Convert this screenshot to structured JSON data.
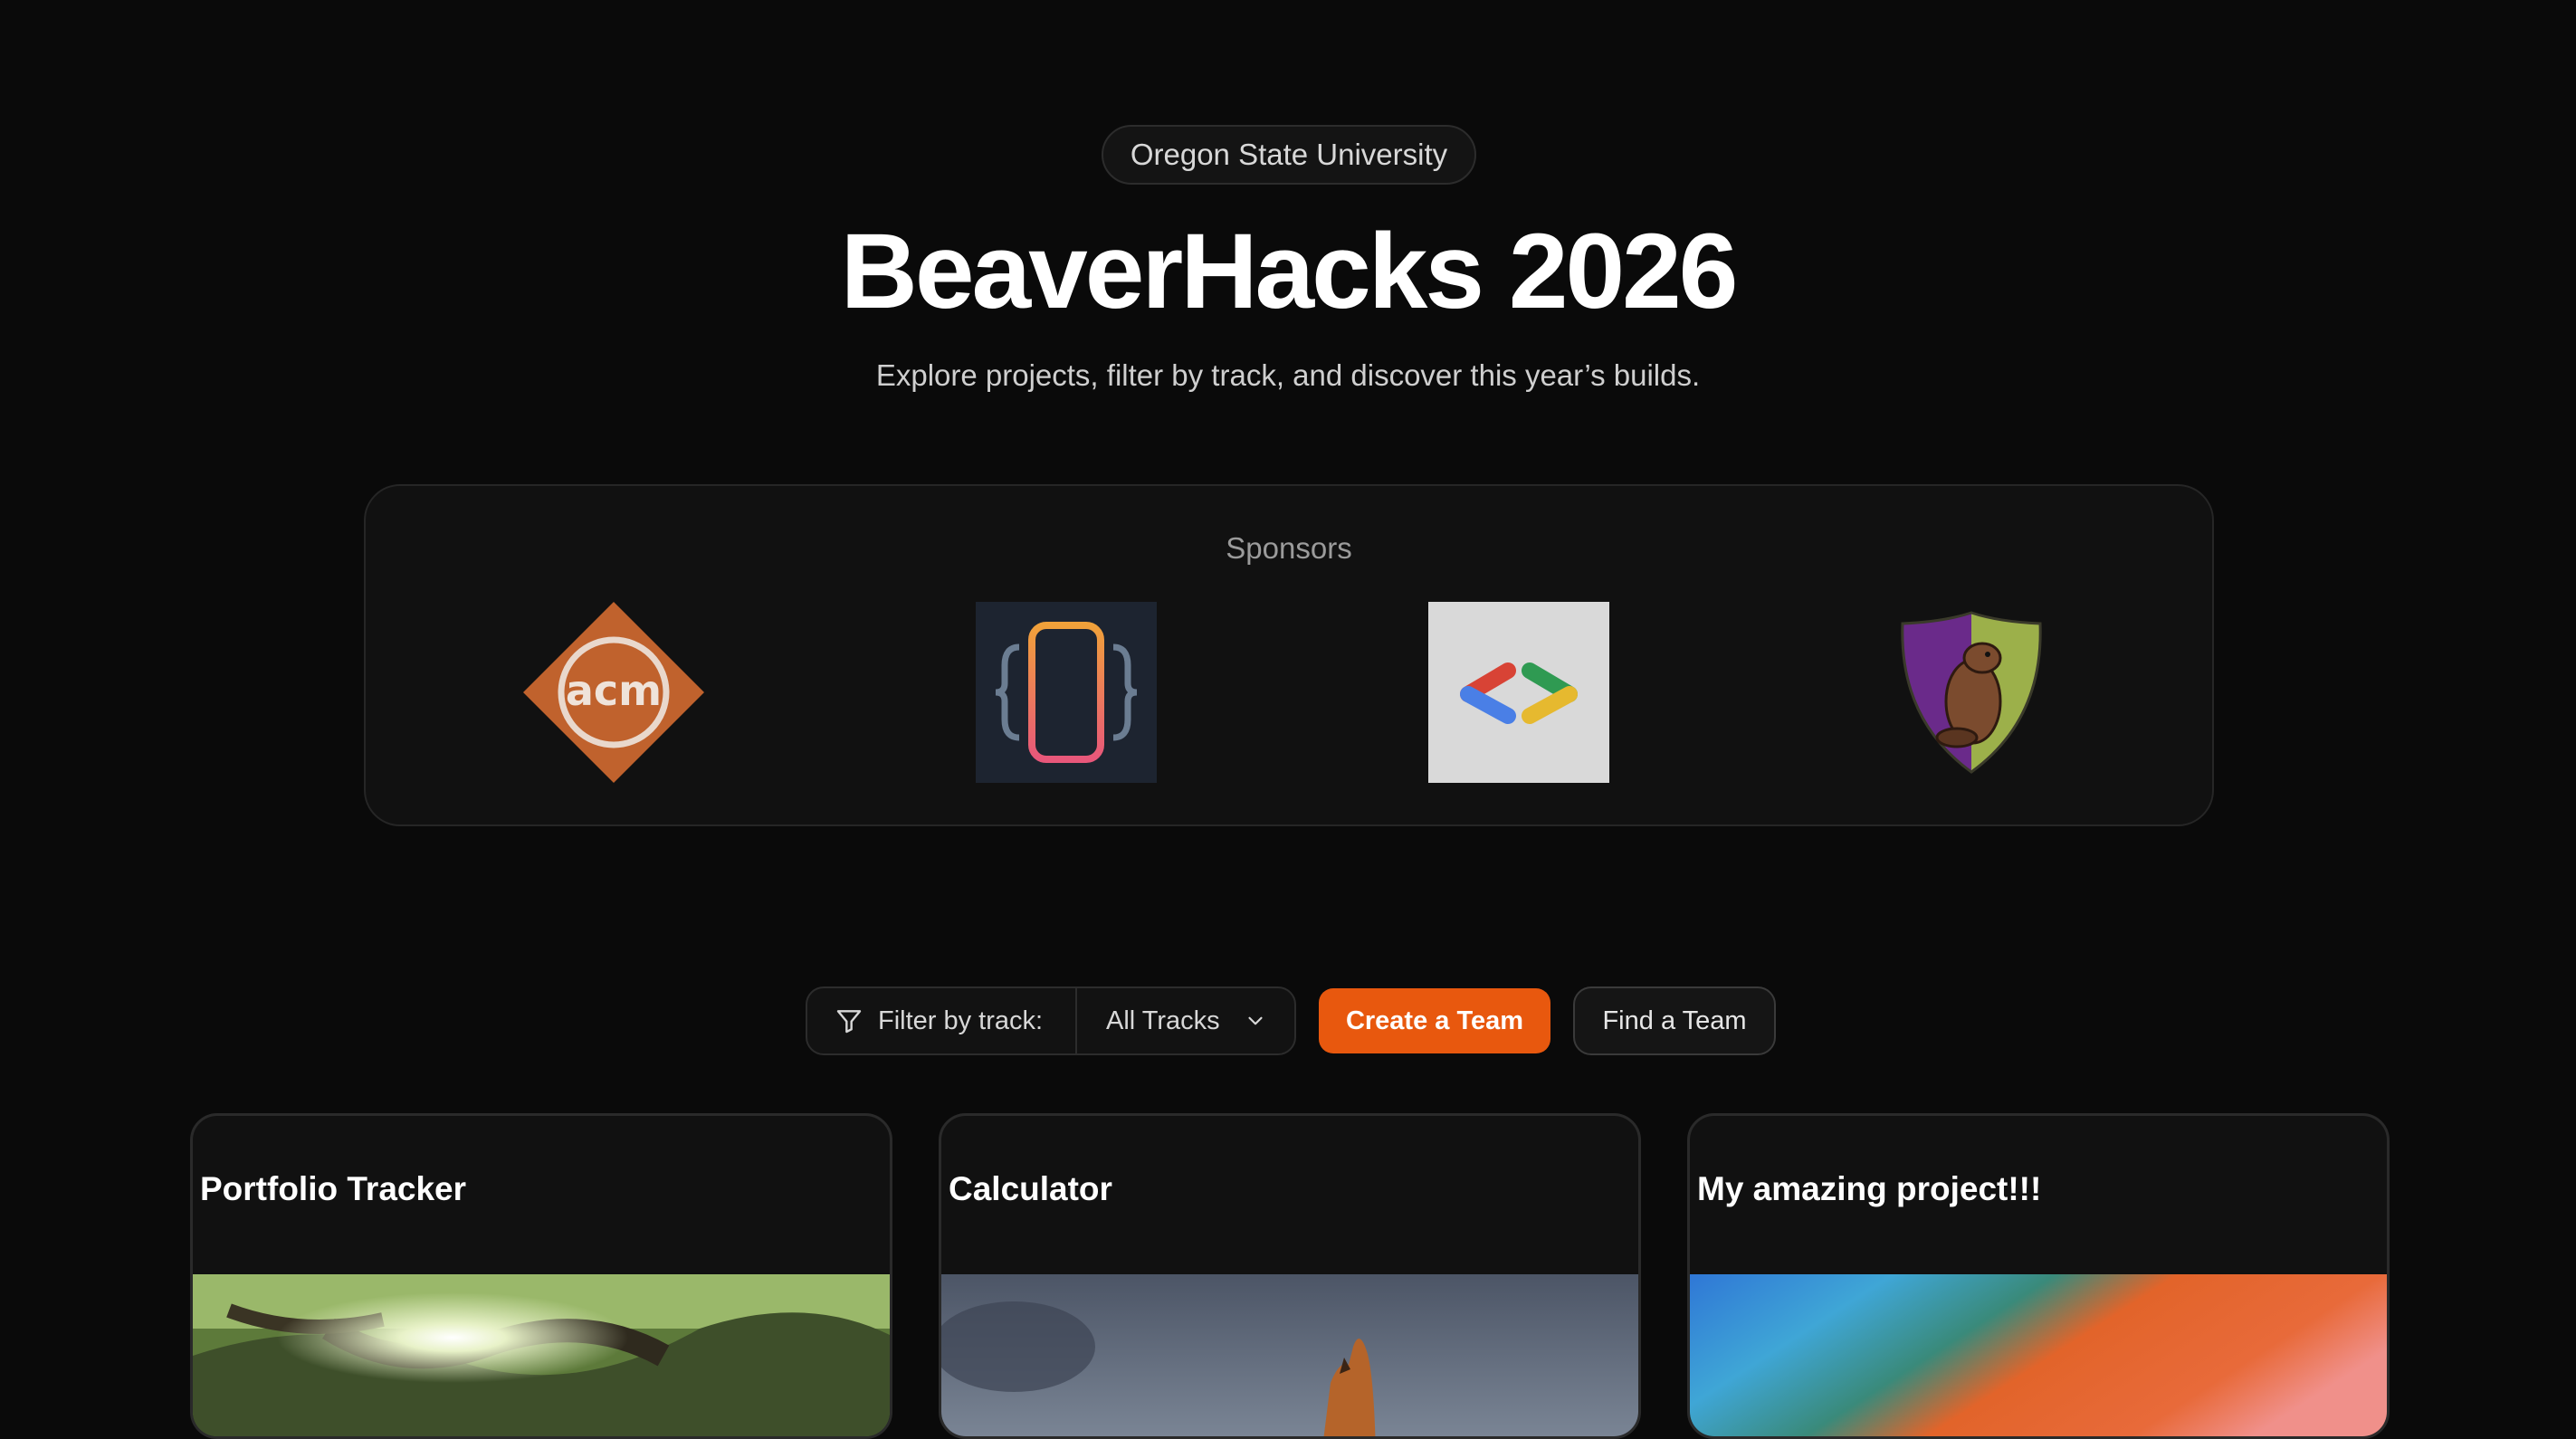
{
  "header": {
    "badge": "Oregon State University",
    "title": "BeaverHacks 2026",
    "subtitle": "Explore projects, filter by track, and discover this year’s builds."
  },
  "sponsors": {
    "label": "Sponsors",
    "logos": [
      {
        "name": "acm-logo",
        "text": "acm",
        "color": "#c0622d"
      },
      {
        "name": "code-brackets-logo",
        "color": "#1d2430"
      },
      {
        "name": "google-developers-logo",
        "color": "#d9d9d9"
      },
      {
        "name": "beaver-shield-logo",
        "color": "#6a2a8a"
      }
    ]
  },
  "toolbar": {
    "filter_label": "Filter by track:",
    "track_selected": "All Tracks",
    "create_team": "Create a Team",
    "find_team": "Find a Team",
    "accent": "#e8580e"
  },
  "projects": [
    {
      "title": "Portfolio Tracker"
    },
    {
      "title": "Calculator"
    },
    {
      "title": "My amazing project!!!"
    }
  ]
}
